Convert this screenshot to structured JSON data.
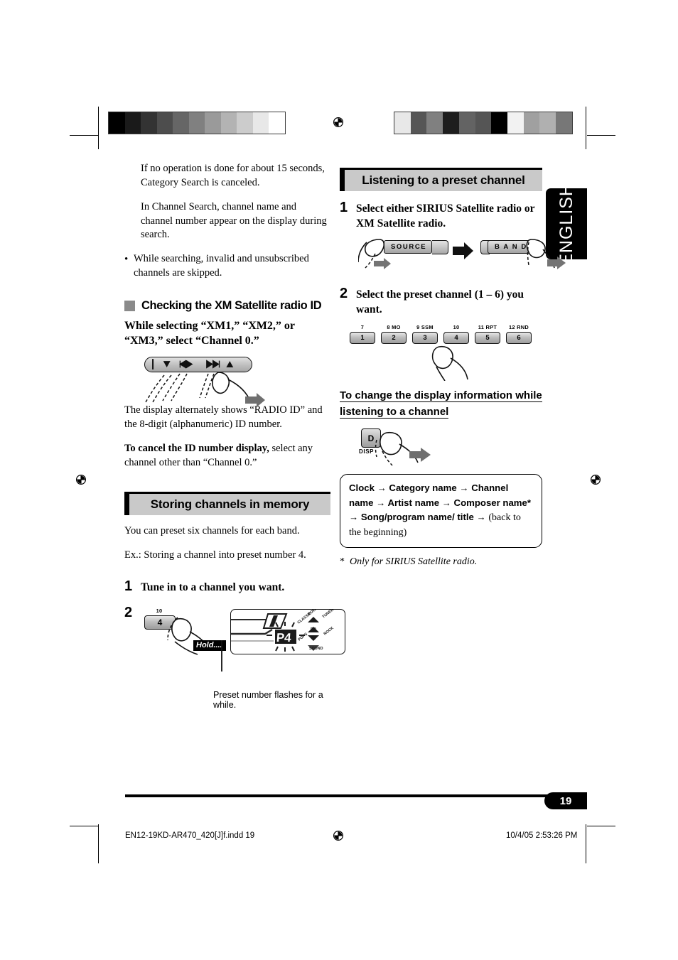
{
  "page": {
    "language_tab": "ENGLISH",
    "page_number": "19",
    "footer_left": "EN12-19KD-AR470_420[J]f.indd   19",
    "footer_right": "10/4/05   2:53:26 PM"
  },
  "calibration": {
    "left_bar": [
      "#000000",
      "#1a1a1a",
      "#333333",
      "#4d4d4d",
      "#666666",
      "#808080",
      "#9a9a9a",
      "#b3b3b3",
      "#cccccc",
      "#e8e8e8",
      "#ffffff"
    ],
    "right_bar": [
      "#e8e8e8",
      "#565656",
      "#808080",
      "#1e1e1e",
      "#636363",
      "#555555",
      "#000000",
      "#f2f2f2",
      "#a0a0a0",
      "#b0b0b0",
      "#777777"
    ]
  },
  "left_column": {
    "note_1": "If no operation is done for about 15 seconds, Category Search is canceled.",
    "note_2": "In Channel Search, channel name and channel number appear on the display during search.",
    "bullet_1": "While searching, invalid and unsubscribed channels are skipped.",
    "subhead_xm_id": "Checking the XM Satellite radio ID",
    "xm_id_lead": "While selecting “XM1,” “XM2,” or “XM3,” select “Channel 0.”",
    "xm_id_body": "The display alternately shows “RADIO ID” and the 8-digit (alphanumeric) ID number.",
    "cancel_bold": "To cancel the ID number display,",
    "cancel_rest": " select any channel other than “Channel 0.”",
    "banner_storing": "Storing channels in memory",
    "storing_intro": "You can preset six channels for each band.",
    "storing_example": "Ex.:  Storing a channel into preset number 4.",
    "step1_num": "1",
    "step1_text": "Tune in to a channel you want.",
    "step2_num": "2",
    "preset_key_top": "10",
    "preset_key_label": "4",
    "hold_label": "Hold....",
    "display_value": "P4",
    "caption_preset": "Preset number flashes for a while.",
    "display_icons": [
      "POWER",
      "TUNER",
      "CLASSIC",
      "EQ",
      "ROCK",
      "POPS",
      "SOUND"
    ]
  },
  "right_column": {
    "banner_listening": "Listening to a preset channel",
    "step1_num": "1",
    "step1_text": "Select either SIRIUS Satellite radio or XM Satellite radio.",
    "button_source": "SOURCE",
    "button_band": "B A N D",
    "step2_num": "2",
    "step2_text": "Select the preset channel (1 – 6) you want.",
    "preset_keys": [
      {
        "top": "7",
        "label": "1"
      },
      {
        "top": "8 MO",
        "label": "2"
      },
      {
        "top": "9 SSM",
        "label": "3"
      },
      {
        "top": "10",
        "label": "4"
      },
      {
        "top": "11 RPT",
        "label": "5"
      },
      {
        "top": "12 RND",
        "label": "6"
      }
    ],
    "display_head_line1": "To change the display information while",
    "display_head_line2": "listening to a channel",
    "disp_key_label": "D",
    "disp_key_sub": "DISP",
    "infobox_sequence": "Clock → Category name → Channel name → Artist name → Composer name* → Song/program name/ title → ",
    "infobox_tail": "(back to the beginning)",
    "footnote_star": "*",
    "footnote_text": "Only for SIRIUS Satellite radio."
  }
}
